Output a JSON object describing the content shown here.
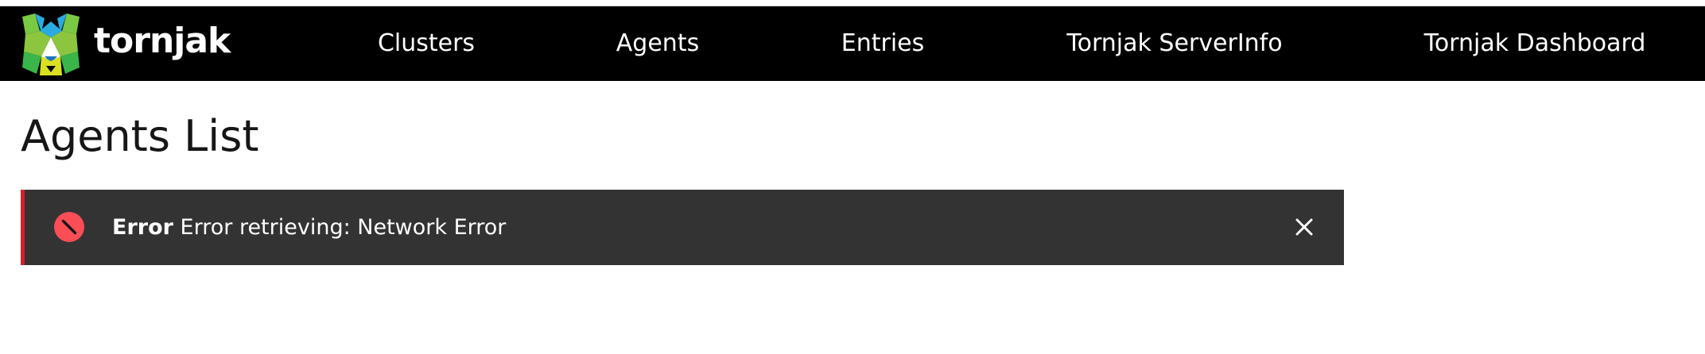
{
  "brand": {
    "name": "tornjak"
  },
  "nav": {
    "items": [
      {
        "label": "Clusters"
      },
      {
        "label": "Agents"
      },
      {
        "label": "Entries"
      },
      {
        "label": "Tornjak ServerInfo"
      },
      {
        "label": "Tornjak Dashboard"
      }
    ]
  },
  "page": {
    "title": "Agents List"
  },
  "notification": {
    "kind": "error",
    "title": "Error",
    "message": "Error retrieving: Network Error",
    "icon": "error-filled-icon",
    "close_icon": "close-icon",
    "accent_color": "#da1e28"
  },
  "colors": {
    "navbar_bg": "#000000",
    "notification_bg": "#333333",
    "error_red": "#da1e28",
    "logo_green": "#7ac943",
    "logo_blue": "#29abe2"
  }
}
